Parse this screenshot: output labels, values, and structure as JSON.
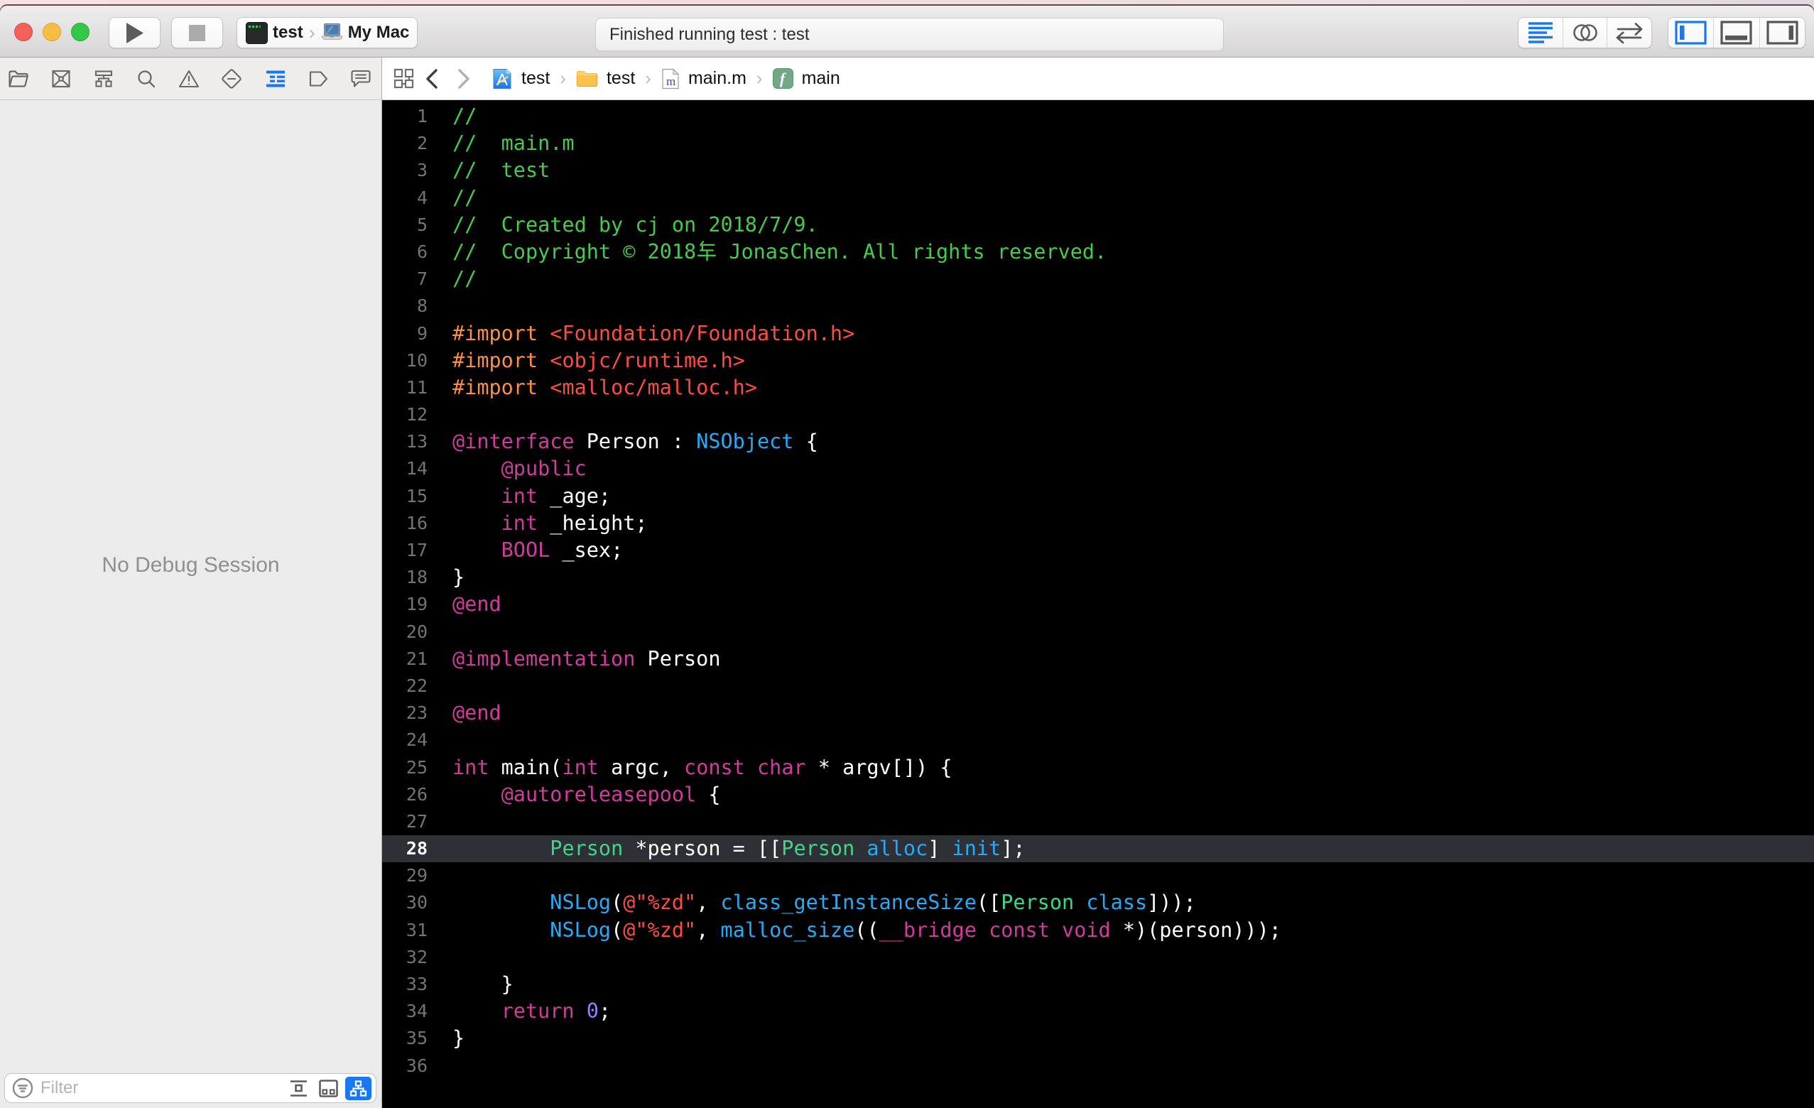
{
  "window": {
    "title": "Xcode"
  },
  "toolbar": {
    "window_controls": [
      "close",
      "minimize",
      "zoom"
    ],
    "run_icon": "play-icon",
    "stop_icon": "stop-icon",
    "scheme": {
      "project": "test",
      "destination": "My Mac",
      "project_icon": "terminal-app-icon",
      "destination_icon": "mac-laptop-icon"
    },
    "status": "Finished running test : test",
    "editor_modes": [
      "standard-editor",
      "assistant-editor",
      "version-editor"
    ],
    "editor_mode_active": "standard-editor",
    "view_toggles": [
      "navigator-panel",
      "debug-area-panel",
      "utilities-panel"
    ],
    "view_toggles_active": [
      "navigator-panel"
    ]
  },
  "navigator": {
    "items": [
      "project",
      "source-control",
      "symbol",
      "find",
      "issue",
      "test",
      "debug",
      "breakpoint",
      "report"
    ],
    "active": "debug",
    "empty_text": "No Debug Session",
    "filter": {
      "placeholder": "Filter",
      "value": "",
      "view_modes": [
        "flat",
        "grouped",
        "hierarchy"
      ],
      "view_mode_active": "hierarchy"
    }
  },
  "jump_bar": {
    "crumbs": [
      {
        "icon": "project-app-icon",
        "label": "test"
      },
      {
        "icon": "folder-icon",
        "label": "test"
      },
      {
        "icon": "objc-file-icon",
        "label": "main.m"
      },
      {
        "icon": "function-icon",
        "label": "main"
      }
    ]
  },
  "editor": {
    "file": "main.m",
    "highlight_line": 28,
    "total_lines": 36,
    "lines": [
      [
        [
          "g",
          "//"
        ]
      ],
      [
        [
          "g",
          "//  main.m"
        ]
      ],
      [
        [
          "g",
          "//  test"
        ]
      ],
      [
        [
          "g",
          "//"
        ]
      ],
      [
        [
          "g",
          "//  Created by cj on 2018/7/9."
        ]
      ],
      [
        [
          "g",
          "//  Copyright © 2018年 JonasChen. All rights reserved."
        ]
      ],
      [
        [
          "g",
          "//"
        ]
      ],
      [],
      [
        [
          "o",
          "#import"
        ],
        [
          "w",
          " "
        ],
        [
          "r",
          "<Foundation/Foundation.h>"
        ]
      ],
      [
        [
          "o",
          "#import"
        ],
        [
          "w",
          " "
        ],
        [
          "r",
          "<objc/runtime.h>"
        ]
      ],
      [
        [
          "o",
          "#import"
        ],
        [
          "w",
          " "
        ],
        [
          "r",
          "<malloc/malloc.h>"
        ]
      ],
      [],
      [
        [
          "m",
          "@interface"
        ],
        [
          "w",
          " Person : "
        ],
        [
          "b",
          "NSObject"
        ],
        [
          "w",
          " {"
        ]
      ],
      [
        [
          "w",
          "    "
        ],
        [
          "m",
          "@public"
        ]
      ],
      [
        [
          "w",
          "    "
        ],
        [
          "m",
          "int"
        ],
        [
          "w",
          " _age;"
        ]
      ],
      [
        [
          "w",
          "    "
        ],
        [
          "m",
          "int"
        ],
        [
          "w",
          " _height;"
        ]
      ],
      [
        [
          "w",
          "    "
        ],
        [
          "m",
          "BOOL"
        ],
        [
          "w",
          " _sex;"
        ]
      ],
      [
        [
          "w",
          "}"
        ]
      ],
      [
        [
          "m",
          "@end"
        ]
      ],
      [],
      [
        [
          "m",
          "@implementation"
        ],
        [
          "w",
          " Person"
        ]
      ],
      [],
      [
        [
          "m",
          "@end"
        ]
      ],
      [],
      [
        [
          "m",
          "int"
        ],
        [
          "w",
          " main("
        ],
        [
          "m",
          "int"
        ],
        [
          "w",
          " argc, "
        ],
        [
          "m",
          "const"
        ],
        [
          "w",
          " "
        ],
        [
          "m",
          "char"
        ],
        [
          "w",
          " * argv[]) {"
        ]
      ],
      [
        [
          "w",
          "    "
        ],
        [
          "m",
          "@autoreleasepool"
        ],
        [
          "w",
          " {"
        ]
      ],
      [],
      [
        [
          "w",
          "        "
        ],
        [
          "p",
          "Person"
        ],
        [
          "w",
          " *person = [["
        ],
        [
          "p",
          "Person"
        ],
        [
          "w",
          " "
        ],
        [
          "b",
          "alloc"
        ],
        [
          "w",
          "] "
        ],
        [
          "b",
          "init"
        ],
        [
          "w",
          "];"
        ]
      ],
      [],
      [
        [
          "w",
          "        "
        ],
        [
          "b",
          "NSLog"
        ],
        [
          "w",
          "("
        ],
        [
          "r",
          "@\"%zd\""
        ],
        [
          "w",
          ", "
        ],
        [
          "b",
          "class_getInstanceSize"
        ],
        [
          "w",
          "(["
        ],
        [
          "p",
          "Person"
        ],
        [
          "w",
          " "
        ],
        [
          "b",
          "class"
        ],
        [
          "w",
          "]));"
        ]
      ],
      [
        [
          "w",
          "        "
        ],
        [
          "b",
          "NSLog"
        ],
        [
          "w",
          "("
        ],
        [
          "r",
          "@\"%zd\""
        ],
        [
          "w",
          ", "
        ],
        [
          "b",
          "malloc_size"
        ],
        [
          "w",
          "(("
        ],
        [
          "m",
          "__bridge"
        ],
        [
          "w",
          " "
        ],
        [
          "m",
          "const"
        ],
        [
          "w",
          " "
        ],
        [
          "m",
          "void"
        ],
        [
          "w",
          " *)(person)));"
        ]
      ],
      [],
      [
        [
          "w",
          "    }"
        ]
      ],
      [
        [
          "w",
          "    "
        ],
        [
          "m",
          "return"
        ],
        [
          "w",
          " "
        ],
        [
          "n",
          "0"
        ],
        [
          "w",
          ";"
        ]
      ],
      [
        [
          "w",
          "}"
        ]
      ],
      []
    ]
  },
  "colors": {
    "accent_blue": "#1778f2",
    "editor_background": "#000000",
    "highlight_line_background": "#2e3036",
    "line_number": "#747474",
    "syntax": {
      "w": "#ffffff",
      "g": "#45cc4b",
      "m": "#d23b9e",
      "b": "#27aaf7",
      "o": "#fd8f3f",
      "r": "#ff4c41",
      "p": "#3cd88a",
      "n": "#8d85f8"
    },
    "traffic_lights": [
      "#f5605a",
      "#f9bd45",
      "#33c748"
    ]
  }
}
